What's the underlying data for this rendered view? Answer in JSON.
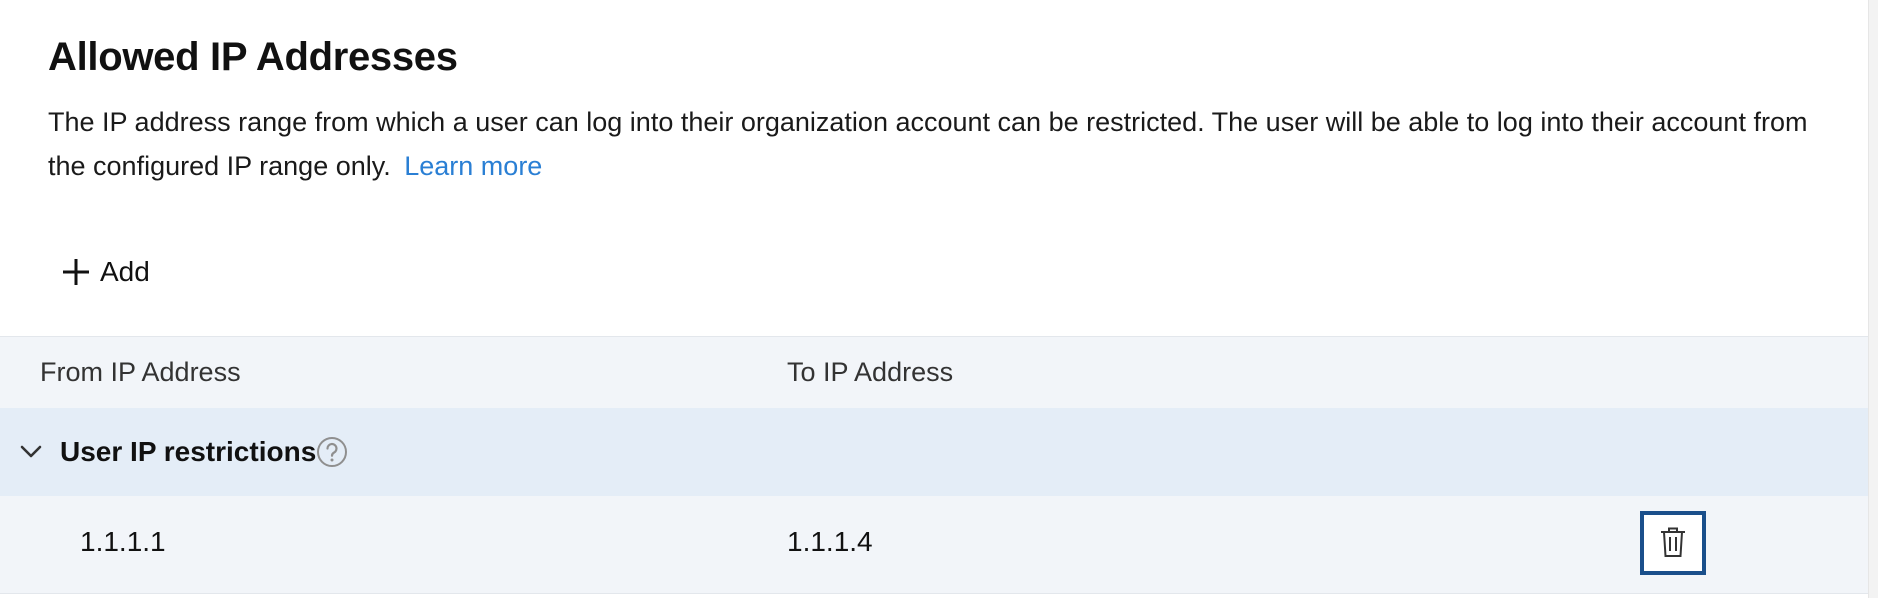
{
  "header": {
    "title": "Allowed IP Addresses",
    "description": "The IP address range from which a user can log into their organization account can be restricted. The user will be able to log into their account from the configured IP range only.",
    "learn_more": "Learn more"
  },
  "toolbar": {
    "add_label": "Add",
    "add_icon": "plus-icon"
  },
  "table": {
    "columns": [
      "From IP Address",
      "To IP Address"
    ],
    "groups": [
      {
        "label": "User IP restrictions",
        "expanded": true,
        "rows": [
          {
            "from": "1.1.1.1",
            "to": "1.1.1.4"
          }
        ]
      }
    ]
  },
  "colors": {
    "link": "#2a7fd4",
    "header_bg": "#f2f5f9",
    "group_bg": "#e4edf7",
    "focus_border": "#1a4f8b"
  }
}
